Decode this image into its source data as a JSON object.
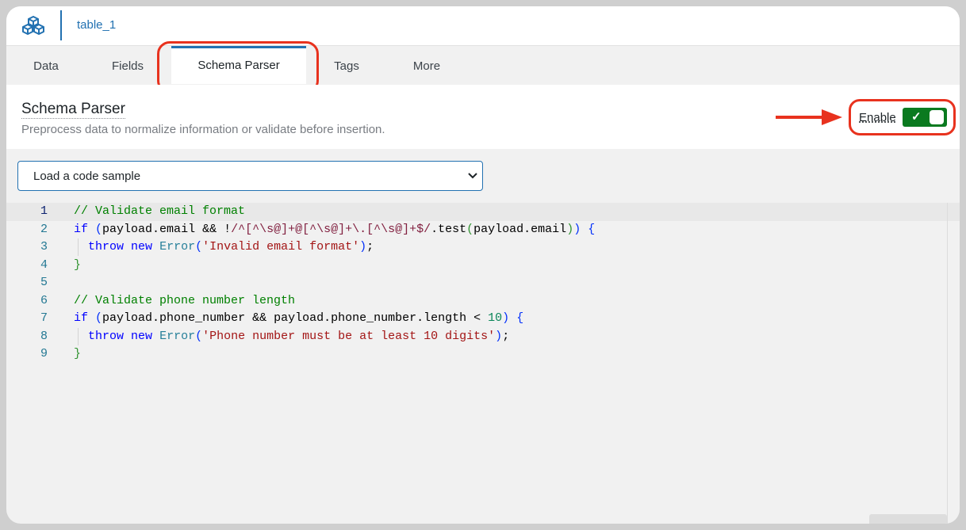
{
  "topbar": {
    "crumb": "table_1"
  },
  "tabs": [
    {
      "label": "Data"
    },
    {
      "label": "Fields"
    },
    {
      "label": "Schema Parser"
    },
    {
      "label": "Tags"
    },
    {
      "label": "More"
    }
  ],
  "header": {
    "title": "Schema Parser",
    "subtitle": "Preprocess data to normalize information or validate before insertion.",
    "enable_label": "Enable",
    "enabled": true
  },
  "sample_select": {
    "value": "Load a code sample"
  },
  "editor": {
    "line_numbers": [
      "1",
      "2",
      "3",
      "4",
      "5",
      "6",
      "7",
      "8",
      "9"
    ],
    "lines": [
      "// Validate email format",
      "if (payload.email && !/^[^\\s@]+@[^\\s@]+\\.[^\\s@]+$/.test(payload.email)) {",
      "  throw new Error('Invalid email format');",
      "}",
      "",
      "// Validate phone number length",
      "if (payload.phone_number && payload.phone_number.length < 10) {",
      "  throw new Error('Phone number must be at least 10 digits');",
      "}"
    ]
  },
  "colors": {
    "accent": "#2271b1",
    "toggle_on": "#0a7a1f",
    "highlight": "#e8321e"
  },
  "icons": [
    "cubes-logo-icon",
    "chevron-down-icon",
    "checkmark-icon",
    "arrow-right-icon"
  ]
}
